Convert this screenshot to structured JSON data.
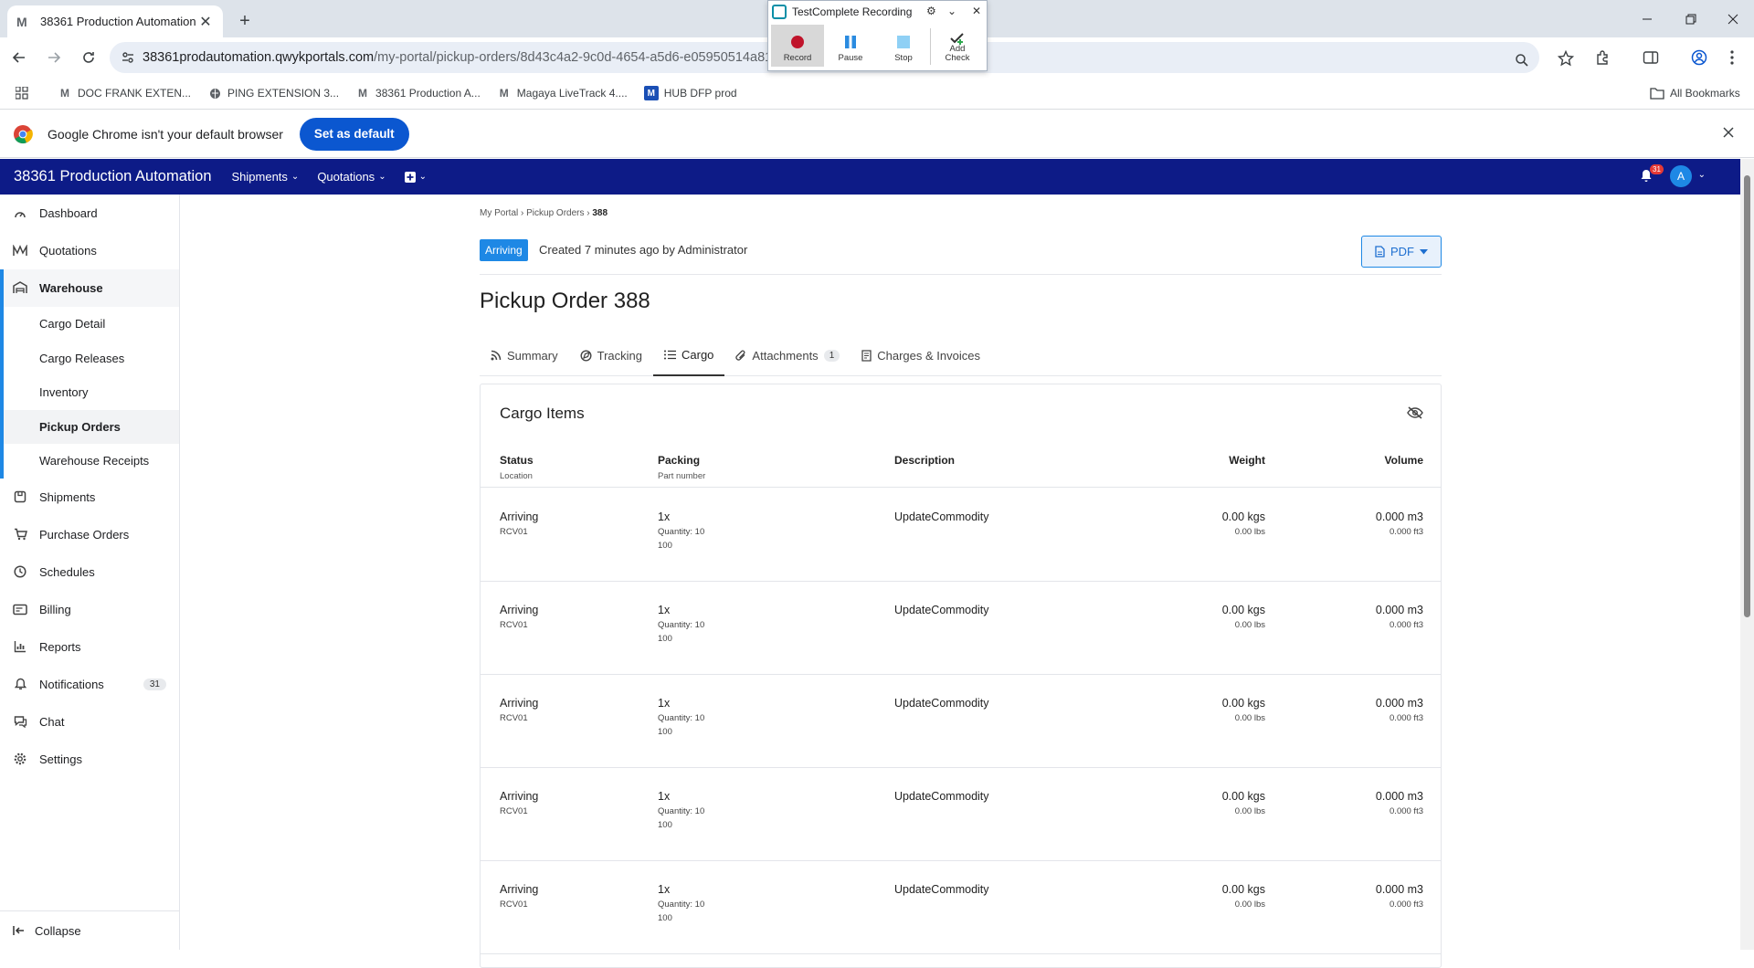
{
  "browser": {
    "tab_title": "38361 Production Automation",
    "tab_favicon": "M",
    "url_host": "38361prodautomation.qwykportals.com",
    "url_path": "/my-portal/pickup-orders/8d43c4a2-9c0d-4654-a5d6-e05950514a81?",
    "bookmarks": [
      {
        "icon": "M",
        "label": "DOC FRANK EXTEN..."
      },
      {
        "icon": "globe",
        "label": "PING EXTENSION 3..."
      },
      {
        "icon": "M",
        "label": "38361 Production A..."
      },
      {
        "icon": "M",
        "label": "Magaya LiveTrack 4...."
      },
      {
        "icon": "M-blue",
        "label": "HUB DFP prod"
      }
    ],
    "all_bookmarks": "All Bookmarks",
    "infobar_text": "Google Chrome isn't your default browser",
    "set_default_label": "Set as default"
  },
  "recorder": {
    "title": "TestComplete Recording",
    "buttons": [
      "Record",
      "Pause",
      "Stop",
      "Add Check"
    ]
  },
  "app": {
    "brand": "38361 Production Automation",
    "nav": [
      "Shipments",
      "Quotations"
    ],
    "notification_count": "31",
    "avatar_letter": "A",
    "accent": "#0d1b87"
  },
  "sidebar": {
    "items_top": [
      {
        "label": "Dashboard",
        "icon": "dashboard-icon"
      },
      {
        "label": "Quotations",
        "icon": "quotations-icon"
      }
    ],
    "warehouse": {
      "label": "Warehouse",
      "children": [
        "Cargo Detail",
        "Cargo Releases",
        "Inventory",
        "Pickup Orders",
        "Warehouse Receipts"
      ],
      "active": "Pickup Orders"
    },
    "items_bottom": [
      {
        "label": "Shipments",
        "icon": "shipments-icon"
      },
      {
        "label": "Purchase Orders",
        "icon": "cart-icon"
      },
      {
        "label": "Schedules",
        "icon": "clock-icon"
      },
      {
        "label": "Billing",
        "icon": "billing-icon"
      },
      {
        "label": "Reports",
        "icon": "chart-icon"
      },
      {
        "label": "Notifications",
        "icon": "bell-icon",
        "badge": "31"
      },
      {
        "label": "Chat",
        "icon": "chat-icon"
      },
      {
        "label": "Settings",
        "icon": "gear-icon"
      }
    ],
    "collapse_label": "Collapse"
  },
  "page": {
    "breadcrumb": [
      "My Portal",
      "Pickup Orders",
      "388"
    ],
    "status": "Arriving",
    "created_text": "Created 7 minutes ago by Administrator",
    "pdf_label": "PDF",
    "title": "Pickup Order 388",
    "tabs": [
      {
        "label": "Summary",
        "icon": "rss-icon"
      },
      {
        "label": "Tracking",
        "icon": "tracking-icon"
      },
      {
        "label": "Cargo",
        "icon": "list-icon"
      },
      {
        "label": "Attachments",
        "icon": "paperclip-icon",
        "count": "1"
      },
      {
        "label": "Charges & Invoices",
        "icon": "invoice-icon"
      }
    ],
    "active_tab": "Cargo"
  },
  "cargo": {
    "title": "Cargo Items",
    "headers": {
      "status": "Status",
      "status_sub": "Location",
      "packing": "Packing",
      "packing_sub": "Part number",
      "description": "Description",
      "weight": "Weight",
      "volume": "Volume"
    },
    "rows": [
      {
        "status": "Arriving",
        "location": "RCV01",
        "packing": "1x",
        "quantity": "Quantity: 10",
        "part": "100",
        "description": "UpdateCommodity",
        "weight": "0.00 kgs",
        "weight_lbs": "0.00 lbs",
        "volume": "0.000 m3",
        "volume_ft": "0.000 ft3"
      },
      {
        "status": "Arriving",
        "location": "RCV01",
        "packing": "1x",
        "quantity": "Quantity: 10",
        "part": "100",
        "description": "UpdateCommodity",
        "weight": "0.00 kgs",
        "weight_lbs": "0.00 lbs",
        "volume": "0.000 m3",
        "volume_ft": "0.000 ft3"
      },
      {
        "status": "Arriving",
        "location": "RCV01",
        "packing": "1x",
        "quantity": "Quantity: 10",
        "part": "100",
        "description": "UpdateCommodity",
        "weight": "0.00 kgs",
        "weight_lbs": "0.00 lbs",
        "volume": "0.000 m3",
        "volume_ft": "0.000 ft3"
      },
      {
        "status": "Arriving",
        "location": "RCV01",
        "packing": "1x",
        "quantity": "Quantity: 10",
        "part": "100",
        "description": "UpdateCommodity",
        "weight": "0.00 kgs",
        "weight_lbs": "0.00 lbs",
        "volume": "0.000 m3",
        "volume_ft": "0.000 ft3"
      },
      {
        "status": "Arriving",
        "location": "RCV01",
        "packing": "1x",
        "quantity": "Quantity: 10",
        "part": "100",
        "description": "UpdateCommodity",
        "weight": "0.00 kgs",
        "weight_lbs": "0.00 lbs",
        "volume": "0.000 m3",
        "volume_ft": "0.000 ft3"
      }
    ]
  }
}
